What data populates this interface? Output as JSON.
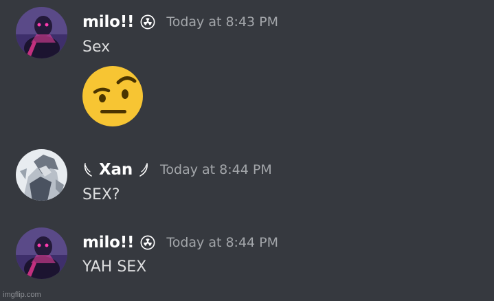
{
  "messages": [
    {
      "username": "milo!!",
      "timestamp": "Today at 8:43 PM",
      "content": "Sex",
      "name_icon": "radioactive-icon"
    },
    {
      "username": "Xan",
      "timestamp": "Today at 8:44 PM",
      "content": "SEX?",
      "name_icon": "feather-icon"
    },
    {
      "username": "milo!!",
      "timestamp": "Today at 8:44 PM",
      "content": "YAH SEX",
      "name_icon": "radioactive-icon"
    }
  ],
  "attachments": {
    "emoji": "face-with-raised-eyebrow-icon"
  },
  "watermark": "imgflip.com",
  "colors": {
    "background": "#36393f",
    "username": "#ffffff",
    "timestamp": "#a3a6aa",
    "message_text": "#dcddde"
  }
}
